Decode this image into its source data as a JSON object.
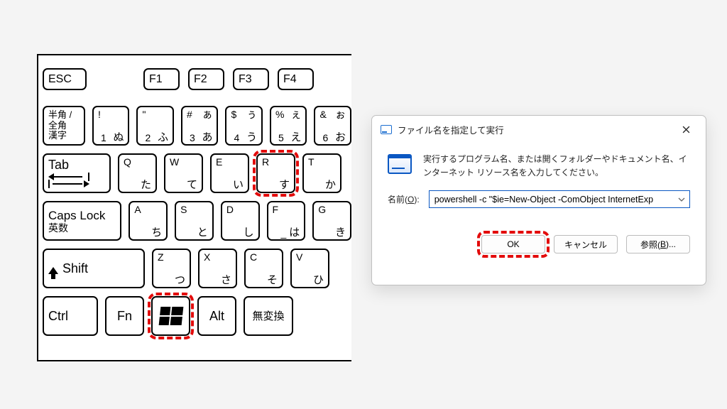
{
  "keyboard": {
    "row0": {
      "esc": "ESC",
      "f1": "F1",
      "f2": "F2",
      "f3": "F3",
      "f4": "F4"
    },
    "row1": {
      "hankaku_line1": "半角 /",
      "hankaku_line2": "全角",
      "hankaku_line3": "漢字",
      "k1_top": "!",
      "k1_bl": "1",
      "k1_br": "ぬ",
      "k2_top": "\"",
      "k2_bl": "2",
      "k2_br": "ふ",
      "k3_top": "#",
      "k3_tr": "ぁ",
      "k3_bl": "3",
      "k3_br": "あ",
      "k4_top": "$",
      "k4_tr": "ぅ",
      "k4_bl": "4",
      "k4_br": "う",
      "k5_top": "%",
      "k5_tr": "ぇ",
      "k5_bl": "5",
      "k5_br": "え",
      "k6_top": "&",
      "k6_tr": "ぉ",
      "k6_bl": "6",
      "k6_br": "お"
    },
    "row2": {
      "tab": "Tab",
      "q": "Q",
      "q_br": "た",
      "w": "W",
      "w_br": "て",
      "e": "E",
      "e_br": "い",
      "r": "R",
      "r_br": "す",
      "t": "T",
      "t_br": "か"
    },
    "row3": {
      "caps_l1": "Caps Lock",
      "caps_l2": "英数",
      "a": "A",
      "a_br": "ち",
      "s": "S",
      "s_br": "と",
      "d": "D",
      "d_br": "し",
      "f": "F",
      "f_br": "は",
      "g": "G",
      "g_br": "き"
    },
    "row4": {
      "shift": "Shift",
      "z": "Z",
      "z_br": "つ",
      "x": "X",
      "x_br": "さ",
      "c": "C",
      "c_br": "そ",
      "v": "V",
      "v_br": "ひ"
    },
    "row5": {
      "ctrl": "Ctrl",
      "fn": "Fn",
      "alt": "Alt",
      "muhenkan": "無変換"
    }
  },
  "dialog": {
    "title": "ファイル名を指定して実行",
    "description": "実行するプログラム名、または開くフォルダーやドキュメント名、インターネット リソース名を入力してください。",
    "label_name_prefix": "名前(",
    "label_name_u": "O",
    "label_name_suffix": "):",
    "command_value": "powershell -c \"$ie=New-Object -ComObject InternetExp",
    "btn_ok": "OK",
    "btn_cancel": "キャンセル",
    "btn_browse_prefix": "参照(",
    "btn_browse_u": "B",
    "btn_browse_suffix": ")..."
  }
}
